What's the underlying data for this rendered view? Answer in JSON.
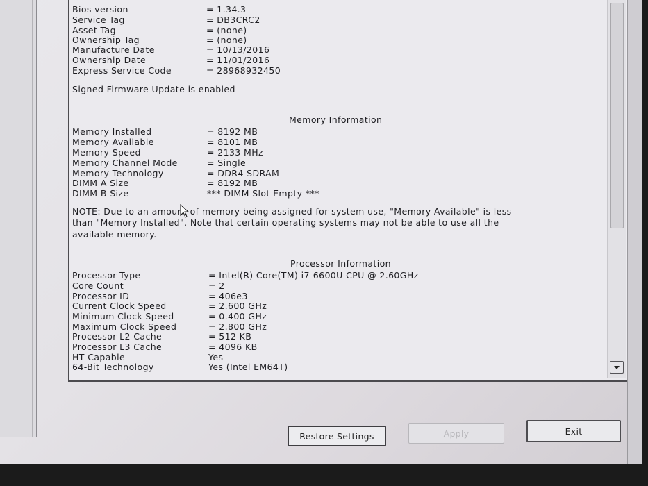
{
  "system_info": [
    {
      "label": "Bios version",
      "value": "= 1.34.3"
    },
    {
      "label": "Service Tag",
      "value": "= DB3CRC2"
    },
    {
      "label": "Asset Tag",
      "value": "= (none)"
    },
    {
      "label": "Ownership Tag",
      "value": "= (none)"
    },
    {
      "label": "Manufacture Date",
      "value": "= 10/13/2016"
    },
    {
      "label": "Ownership Date",
      "value": "= 11/01/2016"
    },
    {
      "label": "Express Service Code",
      "value": "= 28968932450"
    }
  ],
  "firmware_note": "Signed Firmware Update is enabled",
  "memory_section": {
    "title": "Memory Information",
    "rows": [
      {
        "label": "Memory Installed",
        "value": "= 8192 MB"
      },
      {
        "label": "Memory Available",
        "value": "= 8101 MB"
      },
      {
        "label": "Memory Speed",
        "value": "= 2133 MHz"
      },
      {
        "label": "Memory Channel Mode",
        "value": "= Single"
      },
      {
        "label": "Memory Technology",
        "value": "= DDR4 SDRAM"
      },
      {
        "label": "DIMM A Size",
        "value": "= 8192 MB"
      },
      {
        "label": "DIMM B Size",
        "value": "*** DIMM Slot Empty ***"
      }
    ],
    "note_lines": [
      "NOTE: Due to an amount of memory being assigned for system use, \"Memory Available\" is less",
      "than \"Memory Installed\". Note that certain operating systems may not be able to use all the",
      "available memory."
    ]
  },
  "processor_section": {
    "title": "Processor Information",
    "rows": [
      {
        "label": "Processor Type",
        "value": "= Intel(R) Core(TM) i7-6600U CPU @ 2.60GHz"
      },
      {
        "label": "Core Count",
        "value": "= 2"
      },
      {
        "label": "Processor ID",
        "value": "= 406e3"
      },
      {
        "label": "Current Clock Speed",
        "value": "= 2.600 GHz"
      },
      {
        "label": "Minimum Clock Speed",
        "value": "= 0.400 GHz"
      },
      {
        "label": "Maximum Clock Speed",
        "value": "= 2.800 GHz"
      },
      {
        "label": "Processor L2 Cache",
        "value": "= 512 KB"
      },
      {
        "label": "Processor L3 Cache",
        "value": "= 4096 KB"
      },
      {
        "label": "HT Capable",
        "value": "Yes"
      },
      {
        "label": "64-Bit Technology",
        "value": "Yes (Intel EM64T)"
      }
    ]
  },
  "buttons": {
    "restore": "Restore Settings",
    "apply": "Apply",
    "exit": "Exit"
  }
}
